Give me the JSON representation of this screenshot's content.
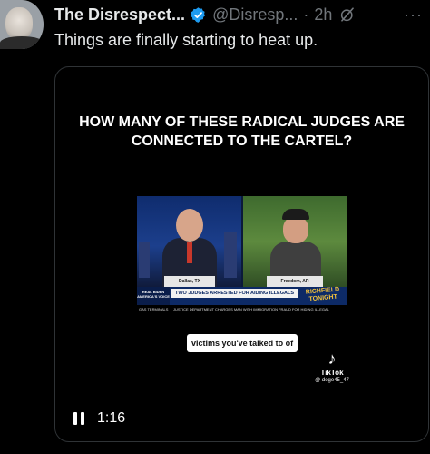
{
  "post": {
    "author_name": "The Disrespect...",
    "handle": "@Disresp...",
    "separator": "·",
    "time": "2h",
    "more": "···",
    "text": "Things are finally starting to heat up.",
    "verified_color": "#1d9bf0"
  },
  "video": {
    "headline": "HOW MANY OF THESE RADICAL JUDGES ARE CONNECTED TO THE CARTEL?",
    "location_left": "Dallas, TX",
    "location_right": "Freedom, AR",
    "chyron_tag": "REAL BIDEN AMERICA'S VOICE",
    "chyron_headline": "TWO JUDGES ARRESTED FOR AIDING ILLEGALS",
    "chyron_logo": "RICHFIELD TONIGHT",
    "ticker_left": "GAS TERMINALS",
    "ticker_text": "JUSTICE DEPARTMENT CHARGES MAN WITH IMMIGRATION FRAUD FOR HIDING ILLEGAL",
    "caption": "victims you've talked to of",
    "tiktok_brand": "TikTok",
    "tiktok_user": "@ doge45_47",
    "duration": "1:16"
  },
  "icons": {
    "verified": "verified-badge-icon",
    "grok": "grok-icon",
    "more": "more-icon",
    "pause": "pause-icon",
    "tiktok": "tiktok-note-icon"
  }
}
